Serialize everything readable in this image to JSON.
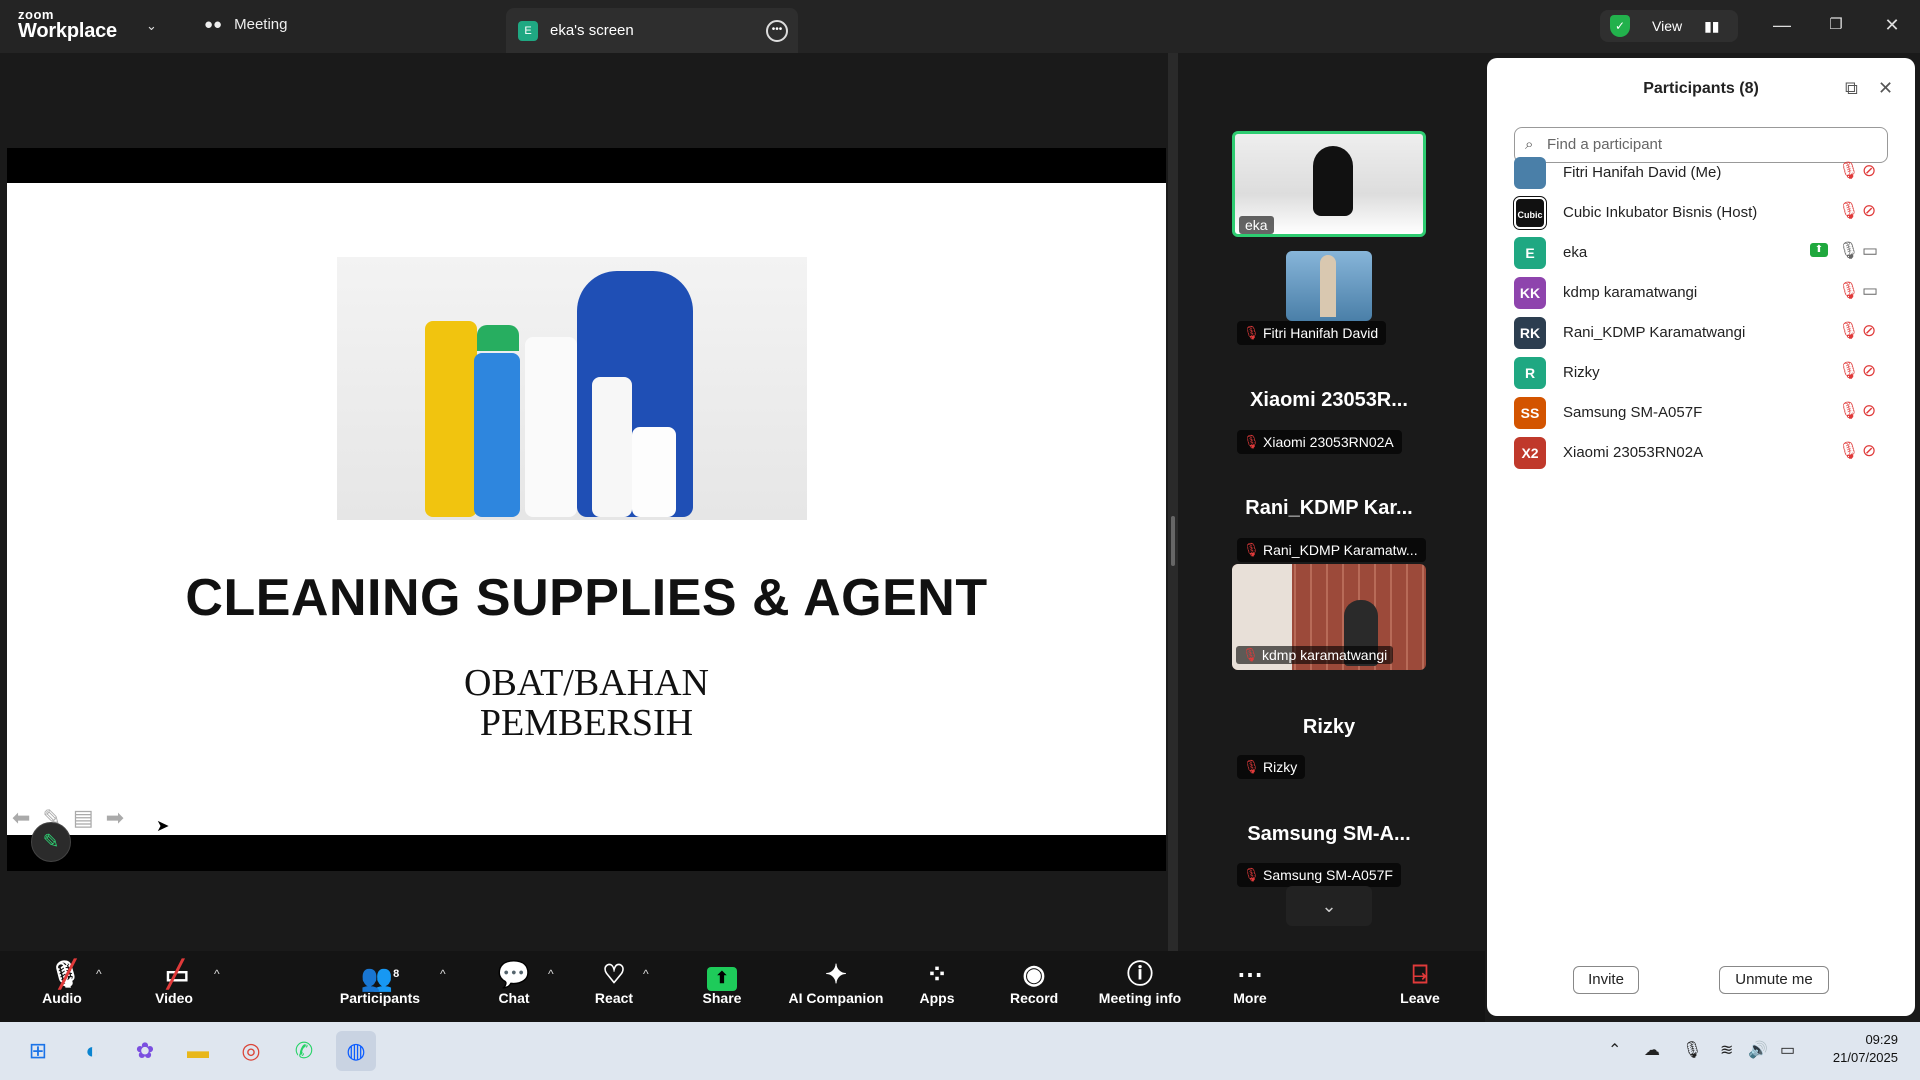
{
  "titlebar": {
    "logo_top": "zoom",
    "logo_bottom": "Workplace",
    "meeting_tab": "Meeting",
    "screen_tab": "eka's screen",
    "screen_tab_avatar": "E",
    "view_label": "View"
  },
  "slide": {
    "title": "CLEANING SUPPLIES & AGENT",
    "subtitle_line1": "OBAT/BAHAN",
    "subtitle_line2": "PEMBERSIH"
  },
  "gallery": {
    "tiles": [
      {
        "label": "eka"
      },
      {
        "label": "Fitri Hanifah David"
      },
      {
        "big": "Xiaomi  23053R...",
        "label": "Xiaomi 23053RN02A"
      },
      {
        "big": "Rani_KDMP  Kar...",
        "label": "Rani_KDMP Karamatw..."
      },
      {
        "label": "kdmp karamatwangi"
      },
      {
        "big": "Rizky",
        "label": "Rizky"
      },
      {
        "big": "Samsung  SM-A...",
        "label": "Samsung SM-A057F"
      }
    ]
  },
  "participants": {
    "title": "Participants (8)",
    "search_placeholder": "Find a participant",
    "list": [
      {
        "initials": "",
        "name": "Fitri Hanifah David (Me)",
        "color": "#4a7fa8"
      },
      {
        "initials": "Cubic",
        "name": "Cubic Inkubator Bisnis (Host)",
        "color": "#111111"
      },
      {
        "initials": "E",
        "name": "eka",
        "color": "#1fa882"
      },
      {
        "initials": "KK",
        "name": "kdmp karamatwangi",
        "color": "#8e44ad"
      },
      {
        "initials": "RK",
        "name": "Rani_KDMP Karamatwangi",
        "color": "#2c3e50"
      },
      {
        "initials": "R",
        "name": "Rizky",
        "color": "#1fa882"
      },
      {
        "initials": "SS",
        "name": "Samsung SM-A057F",
        "color": "#d35400"
      },
      {
        "initials": "X2",
        "name": "Xiaomi 23053RN02A",
        "color": "#c0392b"
      }
    ],
    "invite": "Invite",
    "unmute": "Unmute me"
  },
  "toolbar": {
    "audio": "Audio",
    "video": "Video",
    "participants": "Participants",
    "participants_count": "8",
    "chat": "Chat",
    "react": "React",
    "share": "Share",
    "ai": "AI Companion",
    "apps": "Apps",
    "record": "Record",
    "info": "Meeting info",
    "more": "More",
    "leave": "Leave"
  },
  "taskbar": {
    "time": "09:29",
    "date": "21/07/2025"
  },
  "colors": {
    "accent_green": "#1ecb5a",
    "muted_red": "#e03a3a",
    "active_tile_border": "#2ecc71"
  }
}
